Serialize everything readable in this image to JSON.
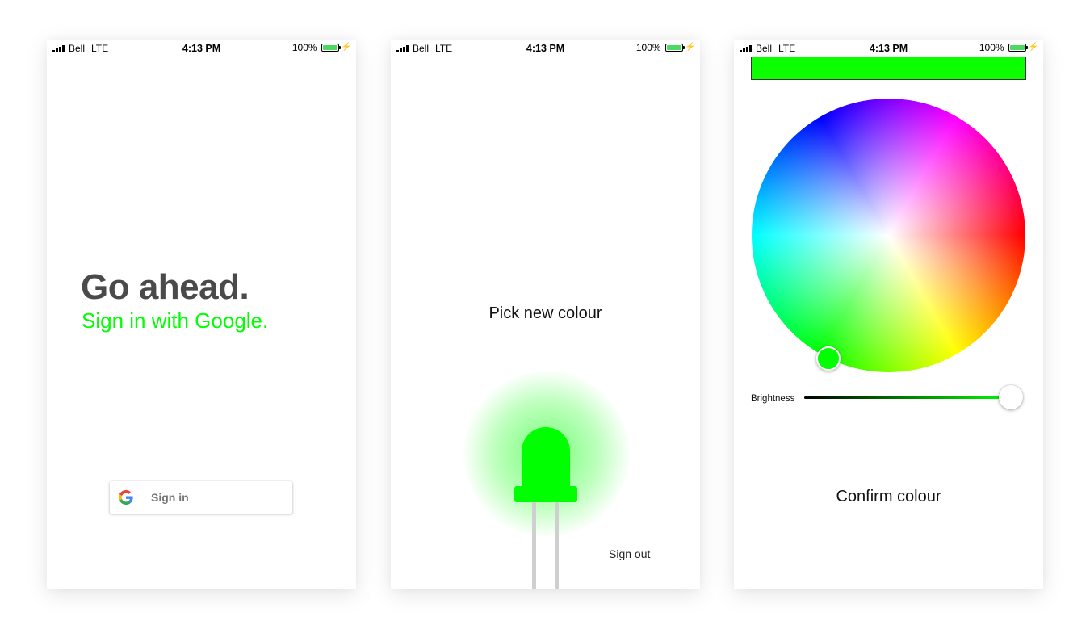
{
  "status_bar": {
    "carrier": "Bell",
    "network": "LTE",
    "time": "4:13 PM",
    "battery": "100%",
    "battery_color": "#4cd964"
  },
  "screen_signin": {
    "headline": "Go ahead.",
    "subline": "Sign in with Google.",
    "subline_color": "#00ff00",
    "button_label": "Sign in",
    "button_icon": "google-logo-icon"
  },
  "screen_led": {
    "pick_label": "Pick new colour",
    "signout_label": "Sign out",
    "led_color": "#00ff00",
    "icon": "led-bulb-icon"
  },
  "screen_picker": {
    "selected_color": "#0bff00",
    "brightness_label": "Brightness",
    "brightness_level": 1.0,
    "confirm_label": "Confirm colour"
  }
}
